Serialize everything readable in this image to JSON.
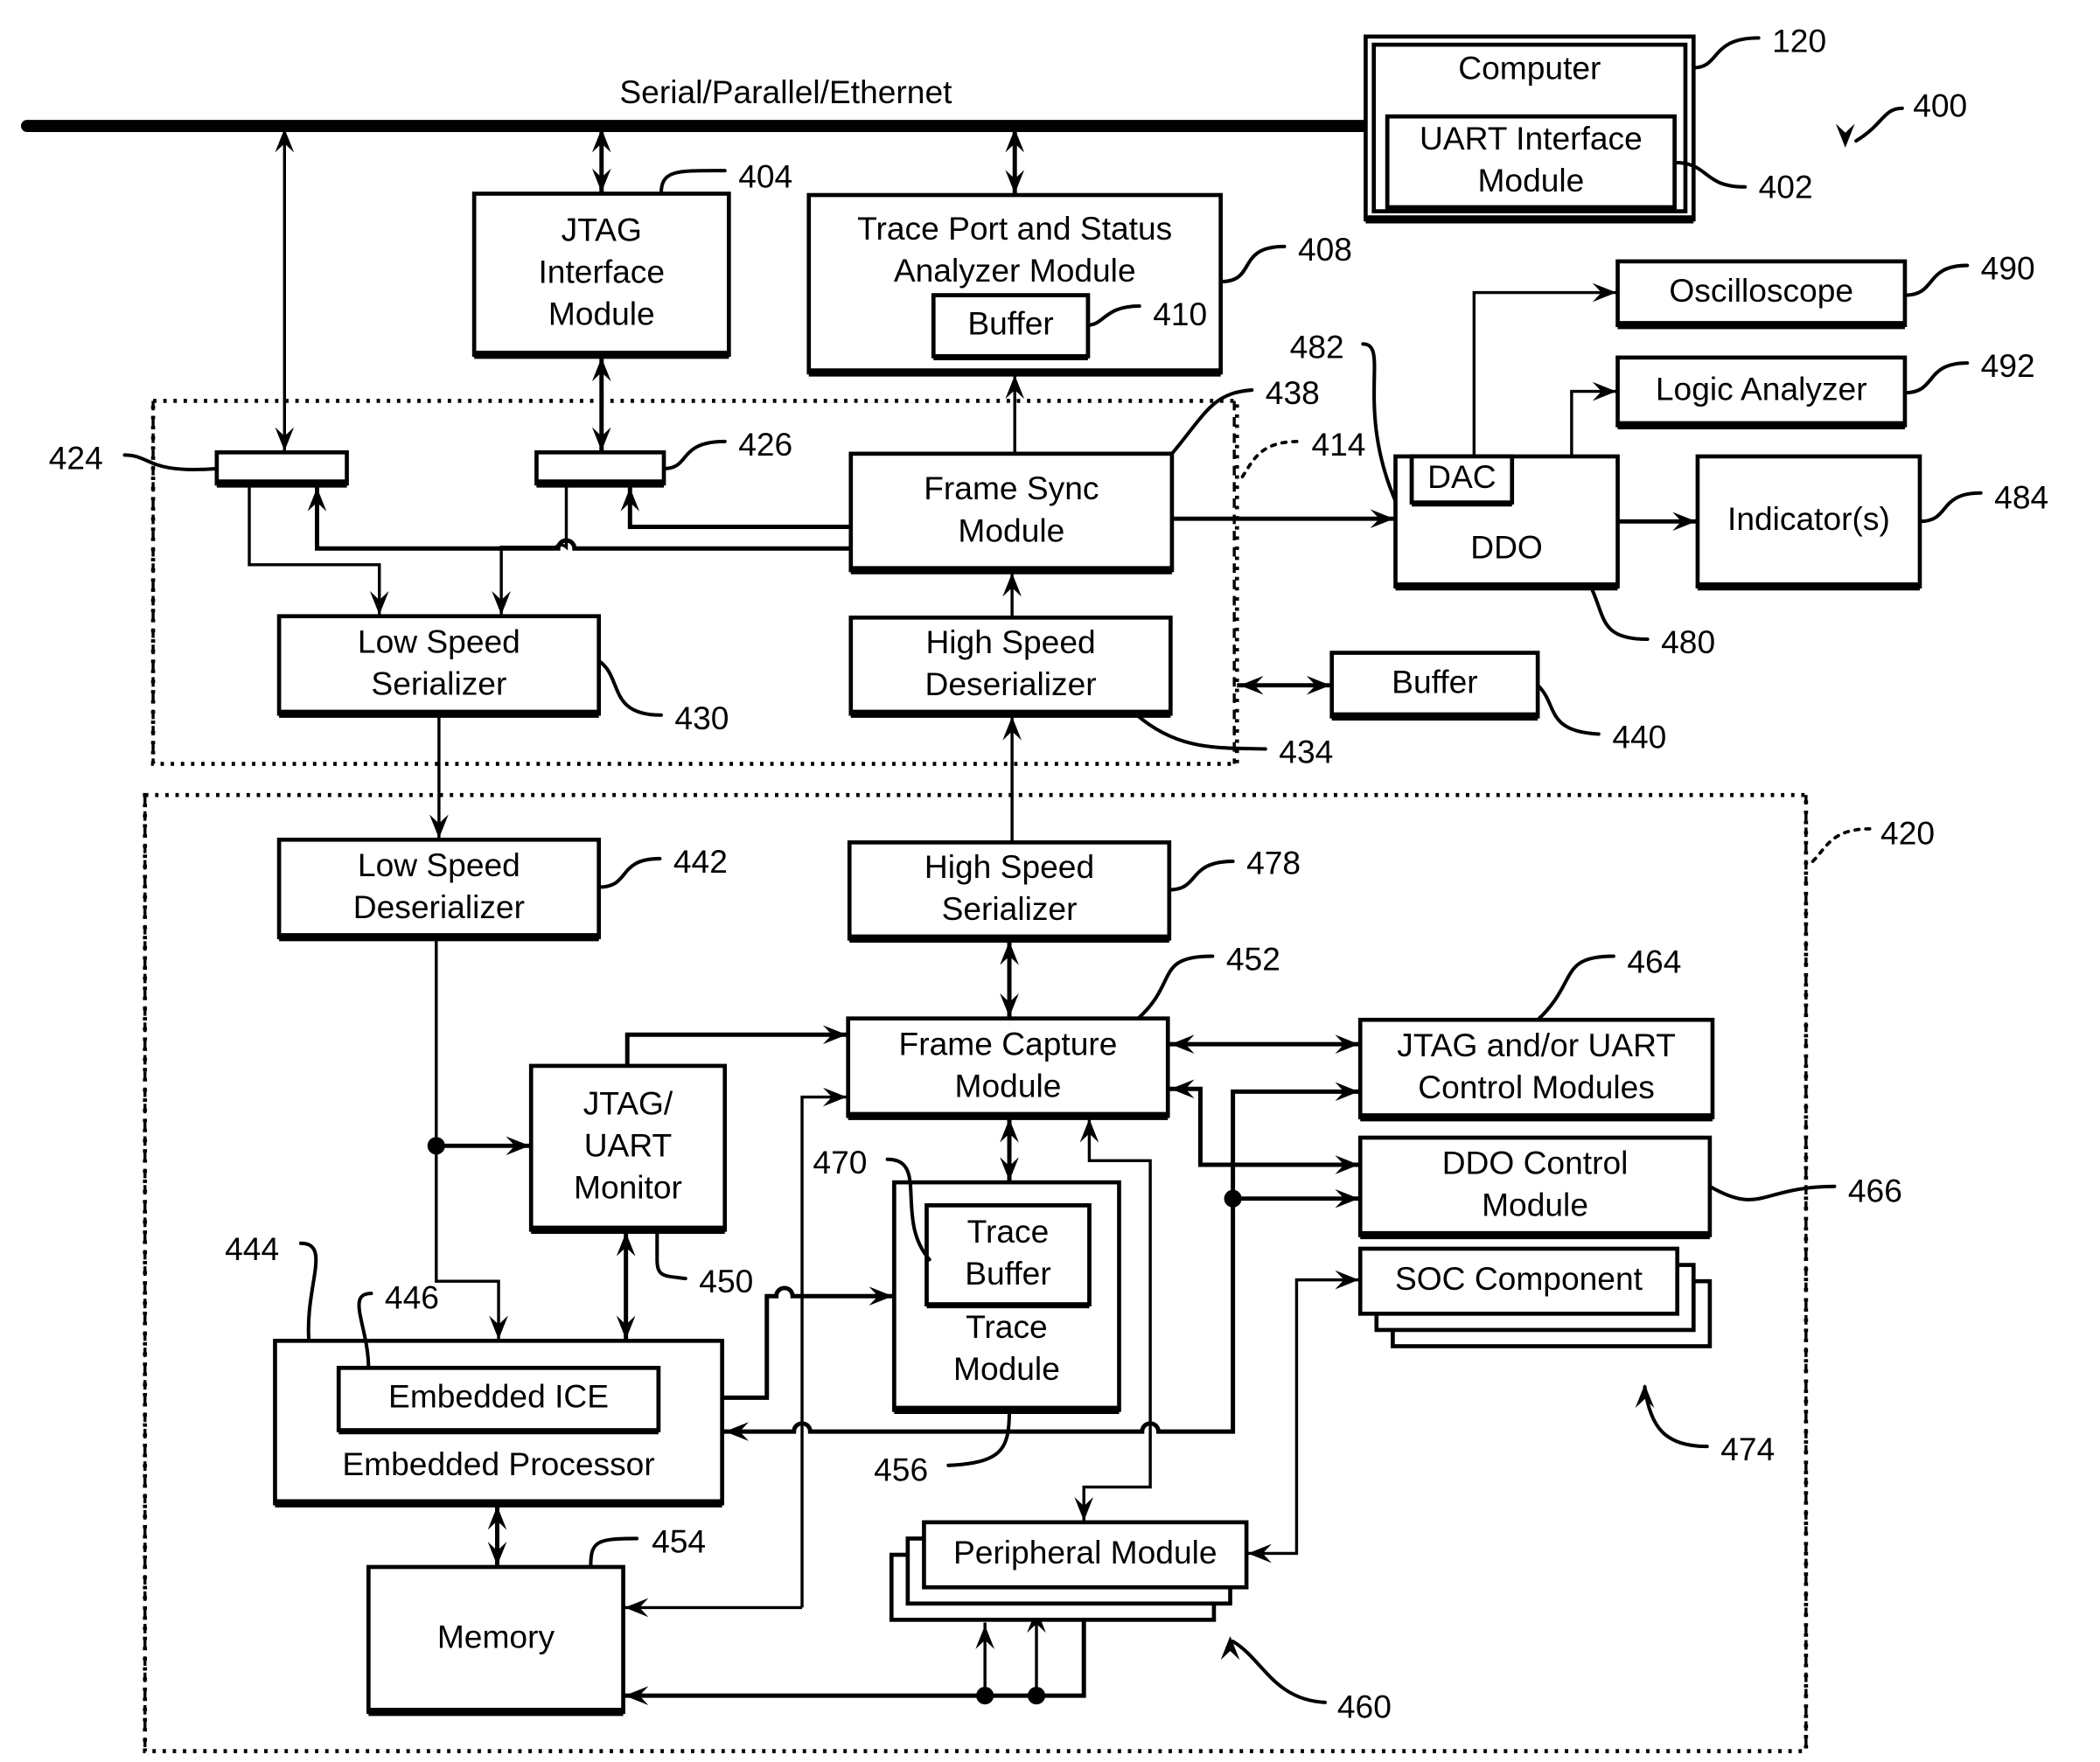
{
  "figure": {
    "number": "400",
    "bus_label": "Serial/Parallel/Ethernet"
  },
  "blocks": {
    "computer": {
      "label": [
        "Computer"
      ],
      "ref": "120"
    },
    "uart_interface": {
      "label": [
        "UART Interface",
        "Module"
      ],
      "ref": "402"
    },
    "jtag_interface": {
      "label": [
        "JTAG",
        "Interface",
        "Module"
      ],
      "ref": "404"
    },
    "trace_port_analyzer": {
      "label": [
        "Trace Port and Status",
        "Analyzer Module"
      ],
      "ref": "408"
    },
    "analyzer_buffer": {
      "label": [
        "Buffer"
      ],
      "ref": "410"
    },
    "oscilloscope": {
      "label": [
        "Oscilloscope"
      ],
      "ref": "490"
    },
    "logic_analyzer": {
      "label": [
        "Logic Analyzer"
      ],
      "ref": "492"
    },
    "switch_424": {
      "label": [],
      "ref": "424"
    },
    "switch_426": {
      "label": [],
      "ref": "426"
    },
    "frame_sync": {
      "label": [
        "Frame Sync",
        "Module"
      ],
      "ref": "438"
    },
    "ddo": {
      "label": [
        "DDO"
      ],
      "ref": "480"
    },
    "dac": {
      "label": [
        "DAC"
      ],
      "ref": "482"
    },
    "indicators": {
      "label": [
        "Indicator(s)"
      ],
      "ref": "484"
    },
    "low_speed_serializer": {
      "label": [
        "Low Speed",
        "Serializer"
      ],
      "ref": "430"
    },
    "high_speed_deserializer": {
      "label": [
        "High Speed",
        "Deserializer"
      ],
      "ref": "434"
    },
    "external_buffer": {
      "label": [
        "Buffer"
      ],
      "ref": "440"
    },
    "low_speed_deserializer": {
      "label": [
        "Low Speed",
        "Deserializer"
      ],
      "ref": "442"
    },
    "high_speed_serializer": {
      "label": [
        "High Speed",
        "Serializer"
      ],
      "ref": "478"
    },
    "frame_capture": {
      "label": [
        "Frame Capture",
        "Module"
      ],
      "ref": "452"
    },
    "jtag_uart_control": {
      "label": [
        "JTAG and/or UART",
        "Control Modules"
      ],
      "ref": "464"
    },
    "ddo_control": {
      "label": [
        "DDO Control",
        "Module"
      ],
      "ref": "466"
    },
    "soc_component": {
      "label": [
        "SOC Component"
      ],
      "ref": "474"
    },
    "jtag_uart_monitor": {
      "label": [
        "JTAG/",
        "UART",
        "Monitor"
      ],
      "ref": "450"
    },
    "trace_module": {
      "label": [
        "Trace",
        "Module"
      ],
      "ref": "456"
    },
    "trace_buffer": {
      "label": [
        "Trace",
        "Buffer"
      ],
      "ref": "470"
    },
    "embedded_processor": {
      "label": [
        "Embedded Processor"
      ],
      "ref": "444"
    },
    "embedded_ice": {
      "label": [
        "Embedded ICE"
      ],
      "ref": "446"
    },
    "memory": {
      "label": [
        "Memory"
      ],
      "ref": "454"
    },
    "peripheral_module": {
      "label": [
        "Peripheral Module"
      ],
      "ref": "460"
    }
  },
  "regions": {
    "probe_region": {
      "ref": "414"
    },
    "target_region": {
      "ref": "420"
    }
  }
}
